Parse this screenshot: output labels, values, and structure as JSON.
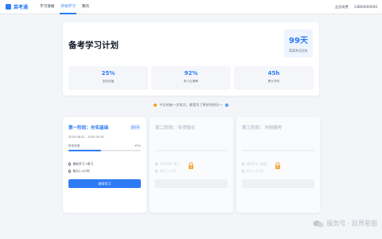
{
  "header": {
    "brand": "菜考通",
    "nav": [
      "学习进展",
      "开始学习",
      "我的"
    ],
    "active_nav": "开始学习",
    "vip": "会员续费",
    "phone": "13800000000"
  },
  "plan": {
    "title": "备考学习计划",
    "countdown_value": "99天",
    "countdown_label": "距离考试还有",
    "stats": [
      {
        "value": "25%",
        "label": "总体进度"
      },
      {
        "value": "92%",
        "label": "练习正确率"
      },
      {
        "value": "45h",
        "label": "累计学时"
      }
    ]
  },
  "motto": "今天的每一步努力，都是为了更好的明天～",
  "stages": [
    {
      "title": "第一阶段：夯实基础",
      "badge": "进行中",
      "dates": "2025.08.01 - 2025.09.30",
      "progress_label": "阶段进度",
      "progress_text": "45%",
      "progress": 0.45,
      "line1": "基础学习+练习",
      "line2": "每天2-4小时",
      "button": "继续学习",
      "locked": false
    },
    {
      "title": "第二阶段：专项强化",
      "badge": "",
      "dates": "",
      "progress_label": "",
      "progress_text": "",
      "progress": 0,
      "line1": "专项突破+练习",
      "line2": "每天3-5小时",
      "button": "",
      "locked": true
    },
    {
      "title": "第三阶段：冲刺模考",
      "badge": "",
      "dates": "",
      "progress_label": "",
      "progress_text": "",
      "progress": 0,
      "line1": "模拟考试+复盘",
      "line2": "每天4-6小时",
      "button": "",
      "locked": true
    }
  ],
  "watermark": "服务号 · 跃界星图",
  "colors": {
    "accent": "#2f7bf6",
    "background": "#f3f5f9",
    "lock": "#f4a53a"
  }
}
